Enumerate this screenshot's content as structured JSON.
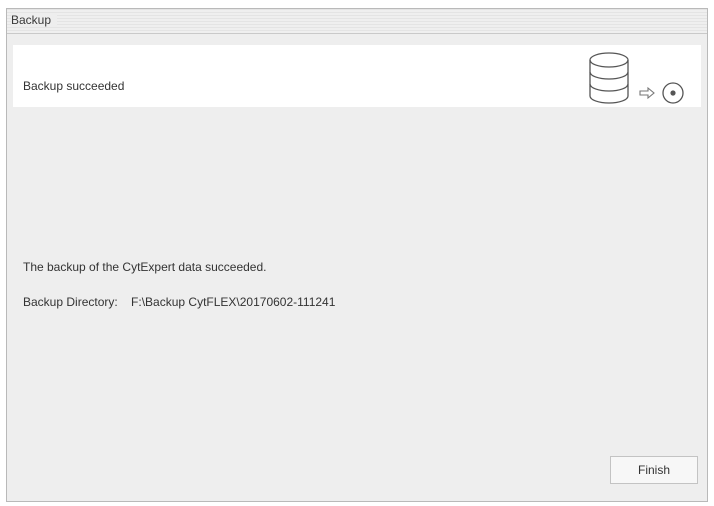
{
  "window": {
    "title": "Backup"
  },
  "header": {
    "status": "Backup succeeded",
    "graphic": {
      "database_icon": "database-icon",
      "arrow_icon": "arrow-right-icon",
      "target_icon": "disc-target-icon"
    }
  },
  "content": {
    "message": "The backup of the CytExpert data succeeded.",
    "directory_label": "Backup Directory:",
    "directory_value": "F:\\Backup CytFLEX\\20170602-111241"
  },
  "buttons": {
    "finish": "Finish"
  },
  "colors": {
    "window_bg": "#eeeeee",
    "header_bg": "#ffffff",
    "border": "#b9b9b9"
  }
}
